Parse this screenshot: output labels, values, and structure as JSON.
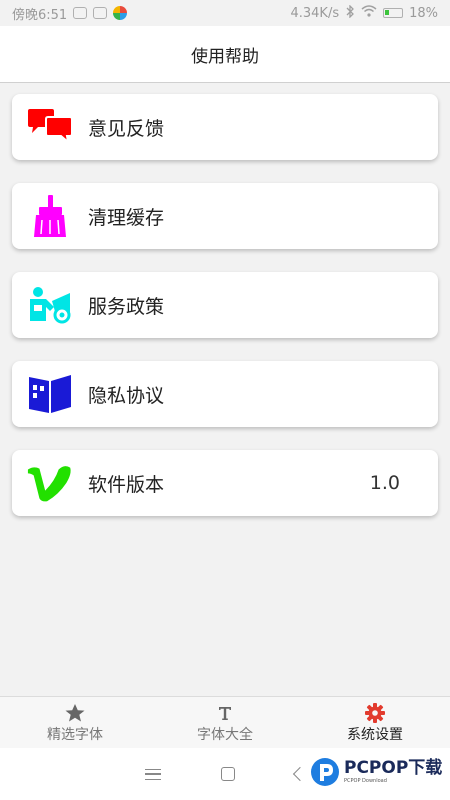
{
  "status_bar": {
    "time": "傍晚6:51",
    "speed": "4.34K/s",
    "battery": "18%"
  },
  "header": {
    "title": "使用帮助"
  },
  "menu": {
    "items": [
      {
        "label": "意见反馈",
        "icon": "feedback-icon",
        "color": "#ff0000"
      },
      {
        "label": "清理缓存",
        "icon": "broom-icon",
        "color": "#ff00ff"
      },
      {
        "label": "服务政策",
        "icon": "service-policy-icon",
        "color": "#00e5e5"
      },
      {
        "label": "隐私协议",
        "icon": "privacy-book-icon",
        "color": "#1a1ad6"
      },
      {
        "label": "软件版本",
        "icon": "version-v-icon",
        "color": "#22e000",
        "value": "1.0"
      }
    ]
  },
  "bottom_nav": {
    "items": [
      {
        "label": "精选字体",
        "icon": "star-icon"
      },
      {
        "label": "字体大全",
        "icon": "text-t-icon"
      },
      {
        "label": "系统设置",
        "icon": "gear-icon",
        "active": true,
        "color": "#e23b2e"
      }
    ]
  },
  "watermark": {
    "brand": "PCPOP下载",
    "sub": "PCPOP Download"
  }
}
